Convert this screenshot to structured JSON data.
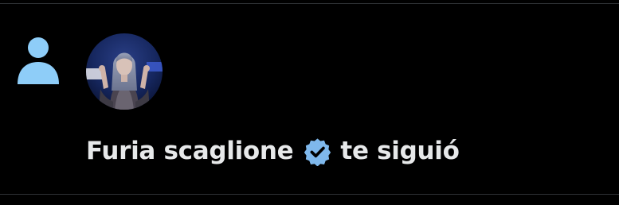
{
  "notification": {
    "type_icon": "person-icon",
    "user": {
      "display_name": "Furia scaglione",
      "verified": true,
      "verified_icon": "verified-badge-icon",
      "avatar_icon": "user-avatar"
    },
    "action_text": "te siguió"
  },
  "colors": {
    "background": "#000000",
    "text": "#e7e9ea",
    "accent": "#8ecdf8",
    "verified": "#7fb8ec",
    "divider": "#2f3336"
  }
}
